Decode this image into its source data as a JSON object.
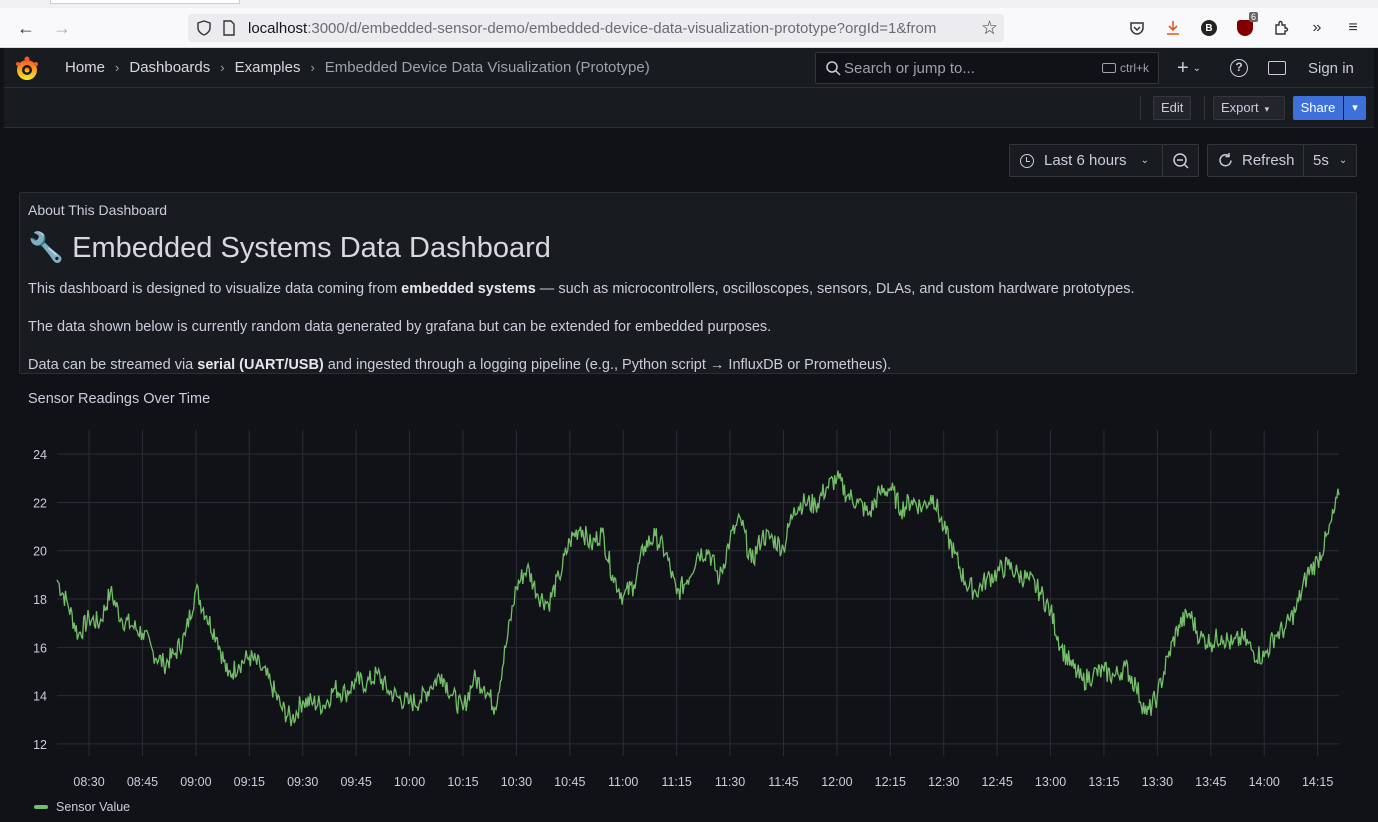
{
  "browser": {
    "url_host": "localhost",
    "url_rest": ":3000/d/embedded-sensor-demo/embedded-device-data-visualization-prototype?orgId=1&from",
    "ext_badge": "B",
    "ublock_count": "6"
  },
  "nav": {
    "breadcrumbs": [
      "Home",
      "Dashboards",
      "Examples",
      "Embedded Device Data Visualization (Prototype)"
    ],
    "search_placeholder": "Search or jump to...",
    "search_shortcut": "ctrl+k",
    "sign_in": "Sign in"
  },
  "toolbar": {
    "edit": "Edit",
    "export": "Export",
    "share": "Share"
  },
  "time": {
    "range": "Last 6 hours",
    "refresh": "Refresh",
    "interval": "5s"
  },
  "about": {
    "title": "About This Dashboard",
    "heading": "🔧 Embedded Systems Data Dashboard",
    "p1_pre": "This dashboard is designed to visualize data coming from ",
    "p1_bold": "embedded systems",
    "p1_post": " — such as microcontrollers, oscilloscopes, sensors, DLAs, and custom hardware prototypes.",
    "p2": "The data shown below is currently random data generated by grafana but can be extended for embedded purposes.",
    "p3_pre": "Data can be streamed via ",
    "p3_bold": "serial (UART/USB)",
    "p3_post": " and ingested through a logging pipeline (e.g., Python script → InfluxDB or Prometheus)."
  },
  "chart_panel": {
    "title": "Sensor Readings Over Time"
  },
  "chart_data": {
    "type": "line",
    "xlabel": "",
    "ylabel": "",
    "ylim": [
      11.5,
      25
    ],
    "y_ticks": [
      12,
      14,
      16,
      18,
      20,
      22,
      24
    ],
    "x_ticks": [
      "08:30",
      "08:45",
      "09:00",
      "09:15",
      "09:30",
      "09:45",
      "10:00",
      "10:15",
      "10:30",
      "10:45",
      "11:00",
      "11:15",
      "11:30",
      "11:45",
      "12:00",
      "12:15",
      "12:30",
      "12:45",
      "13:00",
      "13:15",
      "13:30",
      "13:45",
      "14:00",
      "14:15"
    ],
    "x_start": "08:21",
    "x_end": "14:21",
    "color": "#73bf69",
    "series": [
      {
        "name": "Sensor Value",
        "x": [
          "08:21",
          "08:24",
          "08:27",
          "08:30",
          "08:33",
          "08:36",
          "08:39",
          "08:42",
          "08:45",
          "08:48",
          "08:51",
          "08:54",
          "08:57",
          "09:00",
          "09:03",
          "09:06",
          "09:09",
          "09:12",
          "09:15",
          "09:18",
          "09:21",
          "09:24",
          "09:27",
          "09:30",
          "09:33",
          "09:36",
          "09:39",
          "09:42",
          "09:45",
          "09:48",
          "09:51",
          "09:54",
          "09:57",
          "10:00",
          "10:03",
          "10:06",
          "10:09",
          "10:12",
          "10:15",
          "10:18",
          "10:21",
          "10:24",
          "10:27",
          "10:30",
          "10:33",
          "10:36",
          "10:39",
          "10:42",
          "10:45",
          "10:48",
          "10:51",
          "10:54",
          "10:57",
          "11:00",
          "11:03",
          "11:06",
          "11:09",
          "11:12",
          "11:15",
          "11:18",
          "11:21",
          "11:24",
          "11:27",
          "11:30",
          "11:33",
          "11:36",
          "11:39",
          "11:42",
          "11:45",
          "11:48",
          "11:51",
          "11:54",
          "11:57",
          "12:00",
          "12:03",
          "12:06",
          "12:09",
          "12:12",
          "12:15",
          "12:18",
          "12:21",
          "12:24",
          "12:27",
          "12:30",
          "12:33",
          "12:36",
          "12:39",
          "12:42",
          "12:45",
          "12:48",
          "12:51",
          "12:54",
          "12:57",
          "13:00",
          "13:03",
          "13:06",
          "13:09",
          "13:12",
          "13:15",
          "13:18",
          "13:21",
          "13:24",
          "13:27",
          "13:30",
          "13:33",
          "13:36",
          "13:39",
          "13:42",
          "13:45",
          "13:48",
          "13:51",
          "13:54",
          "13:57",
          "14:00",
          "14:03",
          "14:06",
          "14:09",
          "14:12",
          "14:15",
          "14:18",
          "14:21"
        ],
        "values": [
          18.8,
          17.8,
          16.5,
          17.2,
          17.0,
          18.3,
          17.2,
          16.9,
          16.6,
          15.8,
          15.3,
          15.7,
          16.5,
          18.4,
          17.3,
          16.4,
          14.8,
          15.3,
          15.6,
          15.2,
          14.5,
          13.5,
          13.0,
          13.8,
          13.7,
          13.6,
          14.3,
          14.1,
          14.6,
          14.5,
          14.9,
          14.2,
          13.9,
          13.7,
          13.8,
          14.4,
          14.9,
          14.0,
          13.4,
          14.7,
          14.4,
          13.5,
          16.0,
          18.5,
          19.3,
          18.2,
          17.8,
          18.9,
          20.4,
          21.0,
          20.2,
          20.8,
          19.0,
          18.1,
          18.6,
          20.2,
          20.6,
          19.9,
          18.2,
          18.8,
          19.9,
          20.0,
          18.8,
          20.5,
          21.3,
          19.5,
          20.6,
          20.5,
          20.1,
          21.8,
          22.0,
          21.9,
          22.6,
          23.0,
          22.3,
          22.0,
          21.5,
          22.4,
          22.6,
          21.7,
          22.1,
          21.8,
          22.3,
          20.9,
          19.9,
          18.7,
          18.3,
          18.8,
          19.1,
          19.4,
          19.0,
          18.8,
          18.3,
          17.5,
          16.0,
          15.2,
          14.6,
          14.9,
          15.0,
          14.8,
          15.2,
          14.4,
          13.2,
          14.0,
          15.6,
          16.9,
          17.4,
          16.4,
          16.2,
          16.5,
          16.1,
          16.4,
          15.8,
          15.6,
          16.5,
          16.8,
          17.6,
          19.0,
          19.6,
          20.7,
          22.3
        ]
      }
    ],
    "legend_position": "bottom-left",
    "grid": true
  }
}
